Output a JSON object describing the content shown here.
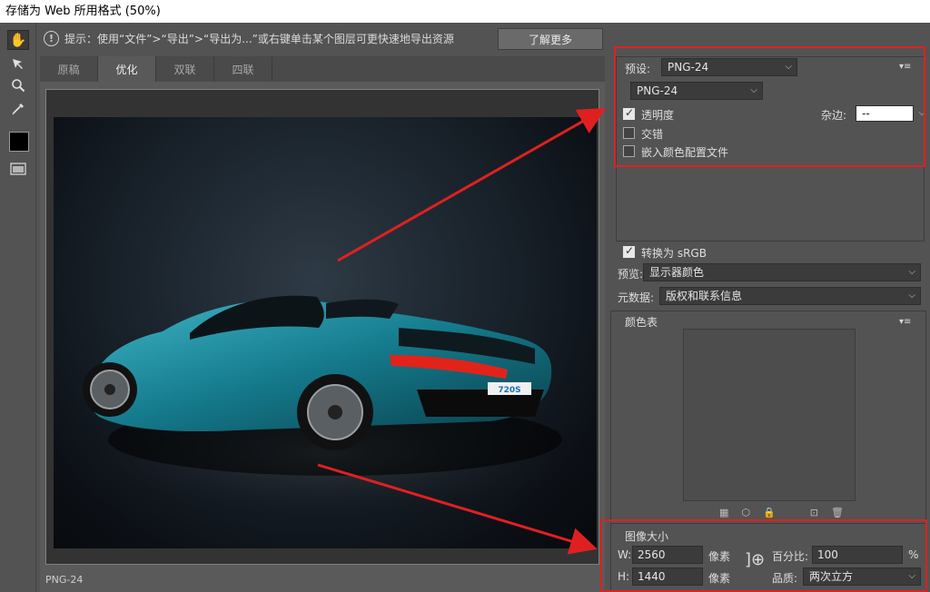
{
  "window": {
    "title": "存储为 Web 所用格式 (50%)"
  },
  "hint": {
    "info_icon": "info-icon",
    "text": "提示：使用“文件”>“导出”>“导出为...”或右键单击某个图层可更快速地导出资源",
    "learn_more": "了解更多"
  },
  "tools": [
    "hand-tool-icon",
    "slice-select-tool-icon",
    "zoom-tool-icon",
    "eyedropper-tool-icon",
    "eyedropper-color-swatch",
    "toggle-slices-visibility-icon"
  ],
  "tabs": [
    {
      "label": "原稿",
      "active": false
    },
    {
      "label": "优化",
      "active": true
    },
    {
      "label": "双联",
      "active": false
    },
    {
      "label": "四联",
      "active": false
    }
  ],
  "canvas": {
    "status": "PNG-24",
    "image_description": "teal convertible sports car on dark studio background",
    "plate_text": "720S"
  },
  "settings": {
    "preset_label": "预设:",
    "preset_value": "PNG-24",
    "format_value": "PNG-24",
    "transparency_label": "透明度",
    "transparency_checked": true,
    "matte_label": "杂边:",
    "matte_value": "--",
    "interlaced_label": "交错",
    "interlaced_checked": false,
    "embed_profile_label": "嵌入颜色配置文件",
    "embed_profile_checked": false,
    "convert_srgb_label": "转换为 sRGB",
    "convert_srgb_checked": true,
    "preview_label": "预览:",
    "preview_value": "显示器颜色",
    "metadata_label": "元数据:",
    "metadata_value": "版权和联系信息"
  },
  "color_table": {
    "title": "颜色表"
  },
  "image_size": {
    "title": "图像大小",
    "w_label": "W:",
    "w_value": "2560",
    "h_label": "H:",
    "h_value": "1440",
    "unit": "像素",
    "percent_label": "百分比:",
    "percent_value": "100",
    "percent_unit": "%",
    "quality_label": "品质:",
    "quality_value": "两次立方"
  },
  "annotation_color": "#e02020"
}
